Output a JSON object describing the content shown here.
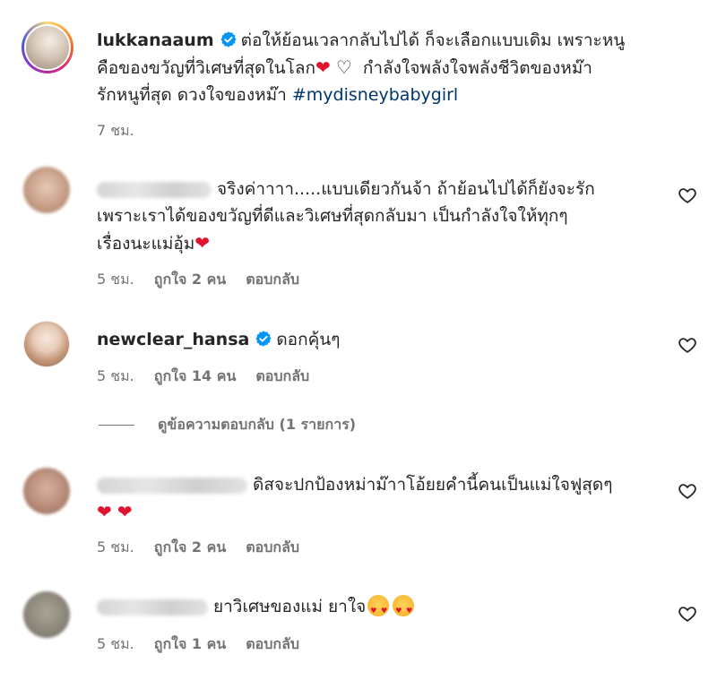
{
  "colors": {
    "text": "#262626",
    "meta": "#737373",
    "hashtag": "#00376b",
    "verified": "#0095f6",
    "heart": "#e0142e"
  },
  "post": {
    "username": "lukkanaaum",
    "line1": "ต่อให้ย้อนเวลากลับไปได้ ก็จะเลือกแบบเดิม เพราะหนู",
    "line2_text": "คือของขวัญที่วิเศษที่สุดในโลก",
    "line2_after": "กำลังใจพลังใจพลังชีวิตของหม๊า",
    "line3_text": "รักหนูที่สุด ดวงใจของหม๊า",
    "hashtag": "#mydisneybabygirl",
    "time": "7 ชม."
  },
  "comments": [
    {
      "line1": "จริงค่าาาา.....แบบเดียวกันจ้า ถ้าย้อนไปได้ก็ยังจะรัก",
      "line2": "เพราะเราได้ของขวัญที่ดีและวิเศษที่สุดกลับมา เป็นกำลังใจให้ทุกๆ",
      "line3": "เรื่องนะแม่อุ้ม",
      "time": "5 ชม.",
      "likes": "ถูกใจ 2 คน",
      "reply": "ตอบกลับ"
    },
    {
      "username": "newclear_hansa",
      "text": "ดอกคุ้นๆ",
      "time": "5 ชม.",
      "likes": "ถูกใจ 14 คน",
      "reply": "ตอบกลับ",
      "view_replies": "ดูข้อความตอบกลับ (1 รายการ)"
    },
    {
      "line1": "ดิสจะปกป้องหม่าม๊าาโอ้ยยคำนี้คนเป็นแม่ใจฟูสุดๆ",
      "time": "5 ชม.",
      "likes": "ถูกใจ 2 คน",
      "reply": "ตอบกลับ"
    },
    {
      "line1": "ยาวิเศษของแม่ ยาใจ",
      "time": "5 ชม.",
      "likes": "ถูกใจ 1 คน",
      "reply": "ตอบกลับ"
    }
  ],
  "icons": {
    "like": "heart-outline-icon",
    "verified": "verified-badge-icon"
  }
}
